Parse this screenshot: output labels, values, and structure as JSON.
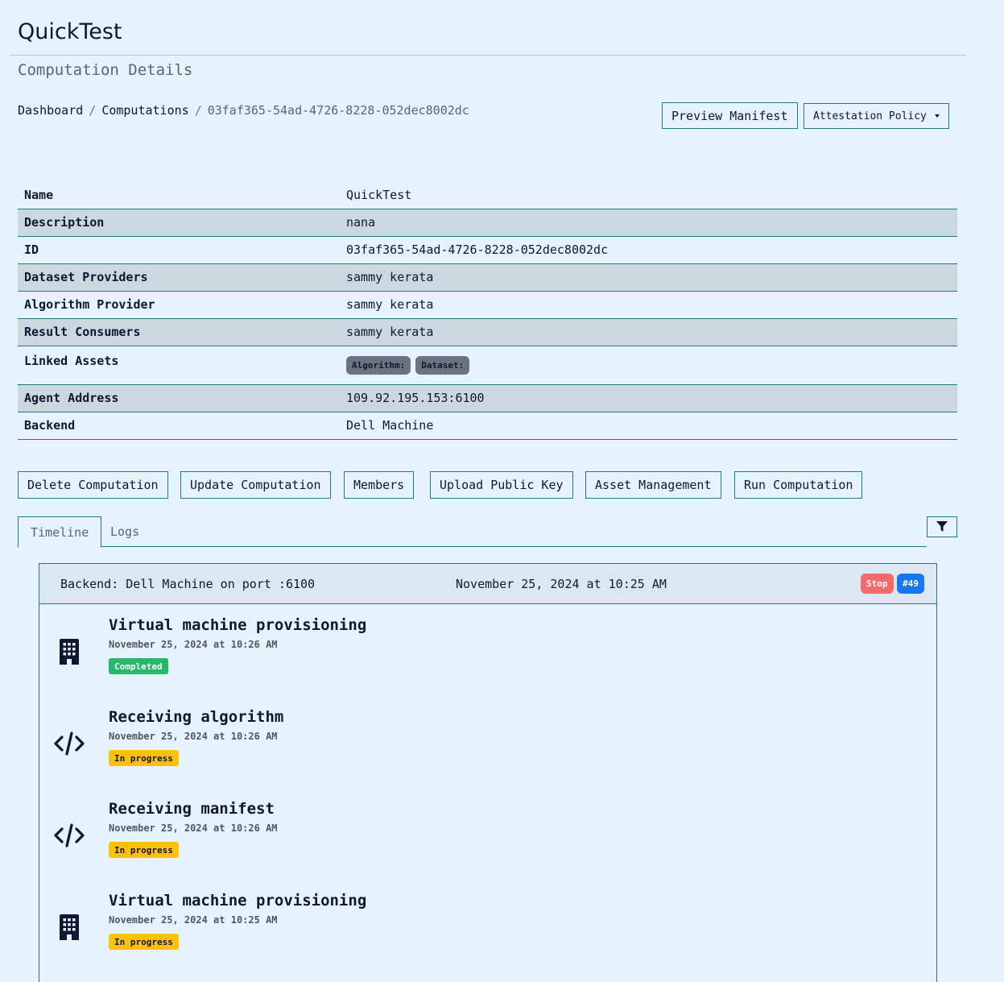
{
  "app": {
    "title": "QuickTest",
    "subtitle": "Computation Details"
  },
  "breadcrumb": {
    "items": [
      "Dashboard",
      "Computations"
    ],
    "separator": "/",
    "current": "03faf365-54ad-4726-8228-052dec8002dc"
  },
  "header_buttons": {
    "preview": "Preview Manifest",
    "attestation": "Attestation Policy"
  },
  "details": {
    "rows": [
      {
        "key": "Name",
        "value": "QuickTest"
      },
      {
        "key": "Description",
        "value": "nana"
      },
      {
        "key": "ID",
        "value": "03faf365-54ad-4726-8228-052dec8002dc"
      },
      {
        "key": "Dataset Providers",
        "value": "sammy kerata"
      },
      {
        "key": "Algorithm Provider",
        "value": "sammy kerata"
      },
      {
        "key": "Result Consumers",
        "value": "sammy kerata"
      },
      {
        "key": "Linked Assets",
        "badges": [
          "Algorithm:",
          "Dataset:"
        ]
      },
      {
        "key": "Agent Address",
        "value": "109.92.195.153:6100"
      },
      {
        "key": "Backend",
        "value": "Dell Machine"
      }
    ]
  },
  "actions": [
    "Delete Computation",
    "Update Computation",
    "Members",
    "Upload Public Key",
    "Asset Management",
    "Run Computation"
  ],
  "tabs": [
    "Timeline",
    "Logs"
  ],
  "icons": {
    "filter": "filter-icon",
    "building": "building-icon",
    "code": "code-icon"
  },
  "run": {
    "backend": "Backend: Dell Machine on port :6100",
    "started": "November 25, 2024 at 10:25 AM",
    "stop_label": "Stop",
    "run_number": "#49"
  },
  "events": [
    {
      "icon": "building-icon",
      "title": "Virtual machine provisioning",
      "time": "November 25, 2024 at 10:26 AM",
      "status": "Completed"
    },
    {
      "icon": "code-icon",
      "title": "Receiving algorithm",
      "time": "November 25, 2024 at 10:26 AM",
      "status": "In progress"
    },
    {
      "icon": "code-icon",
      "title": "Receiving manifest",
      "time": "November 25, 2024 at 10:26 AM",
      "status": "In progress"
    },
    {
      "icon": "building-icon",
      "title": "Virtual machine provisioning",
      "time": "November 25, 2024 at 10:25 AM",
      "status": "In progress"
    }
  ],
  "colors": {
    "background": "#e6f3fc",
    "border": "#227a89",
    "stripe": "#cbd8e0",
    "completed": "#27b86a",
    "in_progress": "#ffc107",
    "stop": "#f26b6b",
    "run_badge": "#1677f2"
  }
}
